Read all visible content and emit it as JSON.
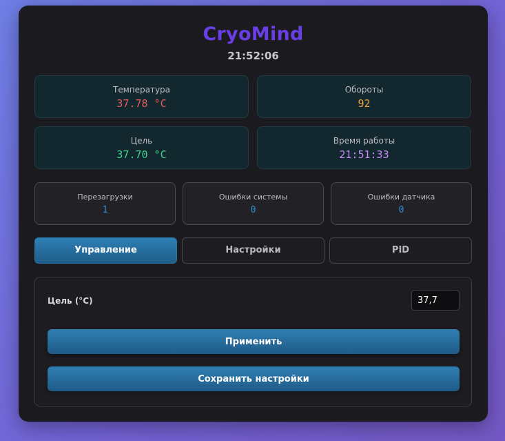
{
  "app": {
    "title": "CryoMind",
    "time": "21:52:06"
  },
  "colors": {
    "brand": "#6a3ee6",
    "temperature": "#e35b5b",
    "rpm": "#f0a53a",
    "target": "#3fd48b",
    "uptime": "#c58af5",
    "counter": "#2f8fd6",
    "accent": "#2e7fb5"
  },
  "stats": {
    "temperature": {
      "label": "Температура",
      "value": "37.78 °C"
    },
    "rpm": {
      "label": "Обороты",
      "value": "92"
    },
    "target": {
      "label": "Цель",
      "value": "37.70 °C"
    },
    "uptime": {
      "label": "Время работы",
      "value": "21:51:33"
    }
  },
  "counters": {
    "reboots": {
      "label": "Перезагрузки",
      "value": "1"
    },
    "system_errors": {
      "label": "Ошибки системы",
      "value": "0"
    },
    "sensor_errors": {
      "label": "Ошибки датчика",
      "value": "0"
    }
  },
  "tabs": [
    {
      "label": "Управление",
      "active": true
    },
    {
      "label": "Настройки",
      "active": false
    },
    {
      "label": "PID",
      "active": false
    }
  ],
  "control": {
    "target_label": "Цель (°C)",
    "target_value": "37,7",
    "apply_label": "Применить",
    "save_label": "Сохранить настройки"
  }
}
